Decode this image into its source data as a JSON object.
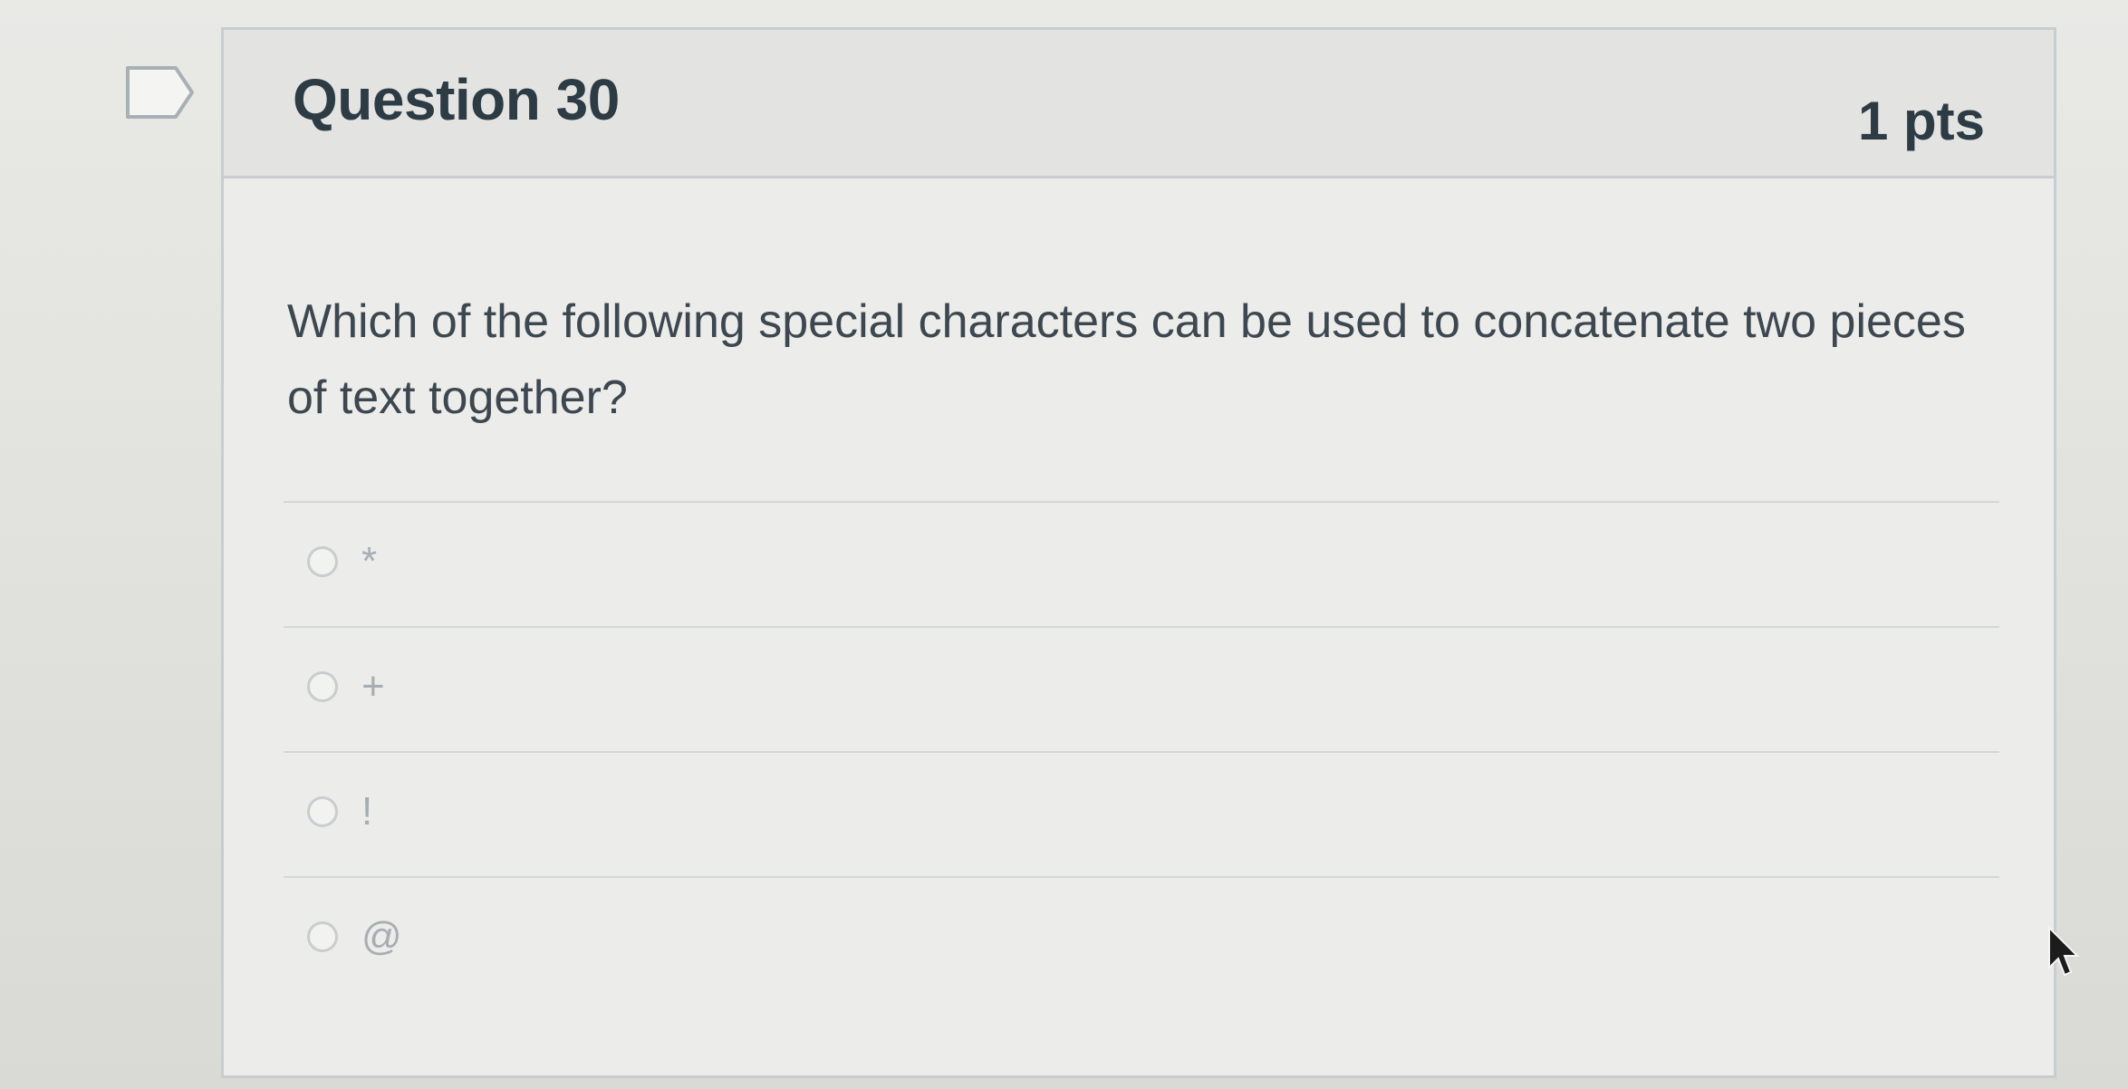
{
  "question": {
    "title": "Question 30",
    "points": "1 pts",
    "text": "Which of the following special characters can be used to concatenate two pieces of text together?",
    "flag_icon": "flag-bookmark-icon"
  },
  "answers": [
    {
      "label": "*",
      "selected": false
    },
    {
      "label": "+",
      "selected": false
    },
    {
      "label": "!",
      "selected": false
    },
    {
      "label": "@",
      "selected": false
    }
  ],
  "colors": {
    "text": "#2d3b45",
    "border": "#c7cdd1",
    "header_bg": "#e3e3e1",
    "answer_text": "#a7aeb3"
  }
}
